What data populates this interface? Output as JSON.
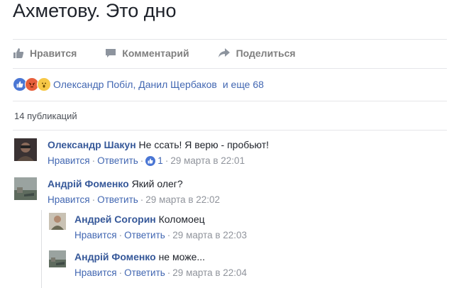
{
  "post": {
    "text_line2": "Ахметову. Это дно"
  },
  "actions": {
    "like": "Нравится",
    "comment": "Комментарий",
    "share": "Поделиться"
  },
  "reactions": {
    "icons": [
      "like-icon",
      "angry-icon",
      "wow-icon"
    ],
    "names": "Олександр Побіл, Данил Щербаков",
    "more": "и еще 68"
  },
  "comments_count": "14 публикаций",
  "comments": [
    {
      "author": "Олександр Шакун",
      "text": "Не ссать! Я верю - пробьют!",
      "like": "Нравится",
      "reply": "Ответить",
      "likes": "1",
      "time": "29 марта в 22:01"
    },
    {
      "author": "Андрій Фоменко",
      "text": "Який олег?",
      "like": "Нравится",
      "reply": "Ответить",
      "time": "29 марта в 22:02"
    }
  ],
  "replies": [
    {
      "author": "Андрей Согорин",
      "text": "Коломоец",
      "like": "Нравится",
      "reply": "Ответить",
      "time": "29 марта в 22:03"
    },
    {
      "author": "Андрій Фоменко",
      "text": "не може...",
      "like": "Нравится",
      "reply": "Ответить",
      "time": "29 марта в 22:04"
    }
  ],
  "colors": {
    "link": "#365899",
    "meta": "#90949c",
    "like_blue": "#4a76d4"
  }
}
